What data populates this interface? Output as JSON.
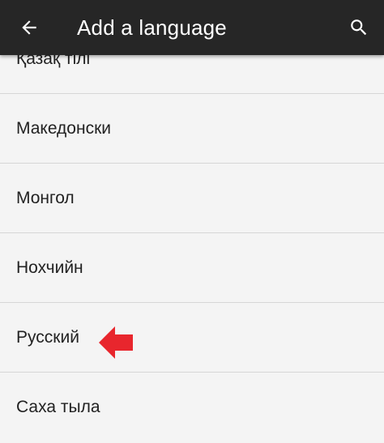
{
  "appbar": {
    "title": "Add a language",
    "back_icon": "arrow-back-icon",
    "search_icon": "search-icon",
    "background": "#262626"
  },
  "languages": [
    {
      "label": "Қазақ тілі"
    },
    {
      "label": "Македонски"
    },
    {
      "label": "Монгол"
    },
    {
      "label": "Нохчийн"
    },
    {
      "label": "Русский"
    },
    {
      "label": "Саха тыла"
    }
  ],
  "annotation": {
    "icon": "red-arrow-pointer-icon",
    "color": "#e8262d",
    "points_to": "Русский"
  }
}
